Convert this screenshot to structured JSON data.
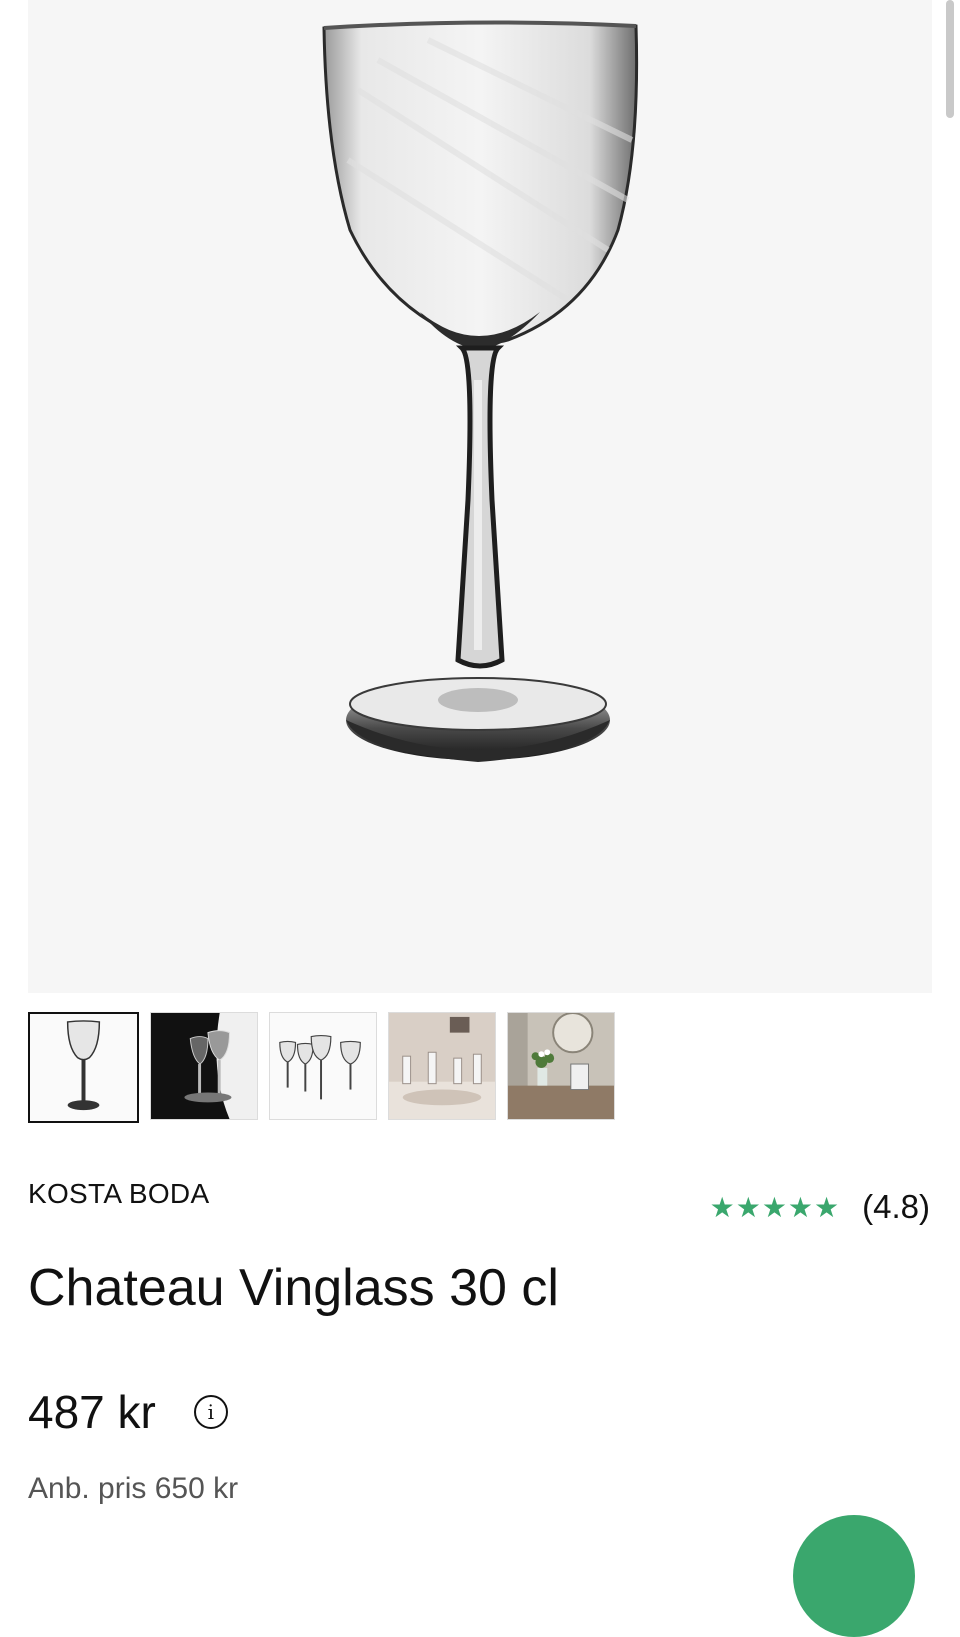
{
  "product": {
    "brand": "KOSTA BODA",
    "title": "Chateau Vinglass 30 cl",
    "price": "487 kr",
    "recommended_price": "Anb. pris 650 kr",
    "rating": {
      "stars": "★★★★★",
      "value": "(4.8)",
      "score": 4.8,
      "max": 5
    },
    "info_icon": "i"
  },
  "gallery": {
    "main_image": "wine-glass-product-photo",
    "thumbnails": [
      {
        "name": "single-glass-white"
      },
      {
        "name": "glasses-dark-background"
      },
      {
        "name": "four-glasses-row"
      },
      {
        "name": "table-setting"
      },
      {
        "name": "dining-room-flowers"
      }
    ],
    "selected_index": 0
  },
  "colors": {
    "accent_green": "#3aa76d",
    "hero_background": "#f6f6f6",
    "text": "#111111",
    "muted_text": "#555555"
  }
}
